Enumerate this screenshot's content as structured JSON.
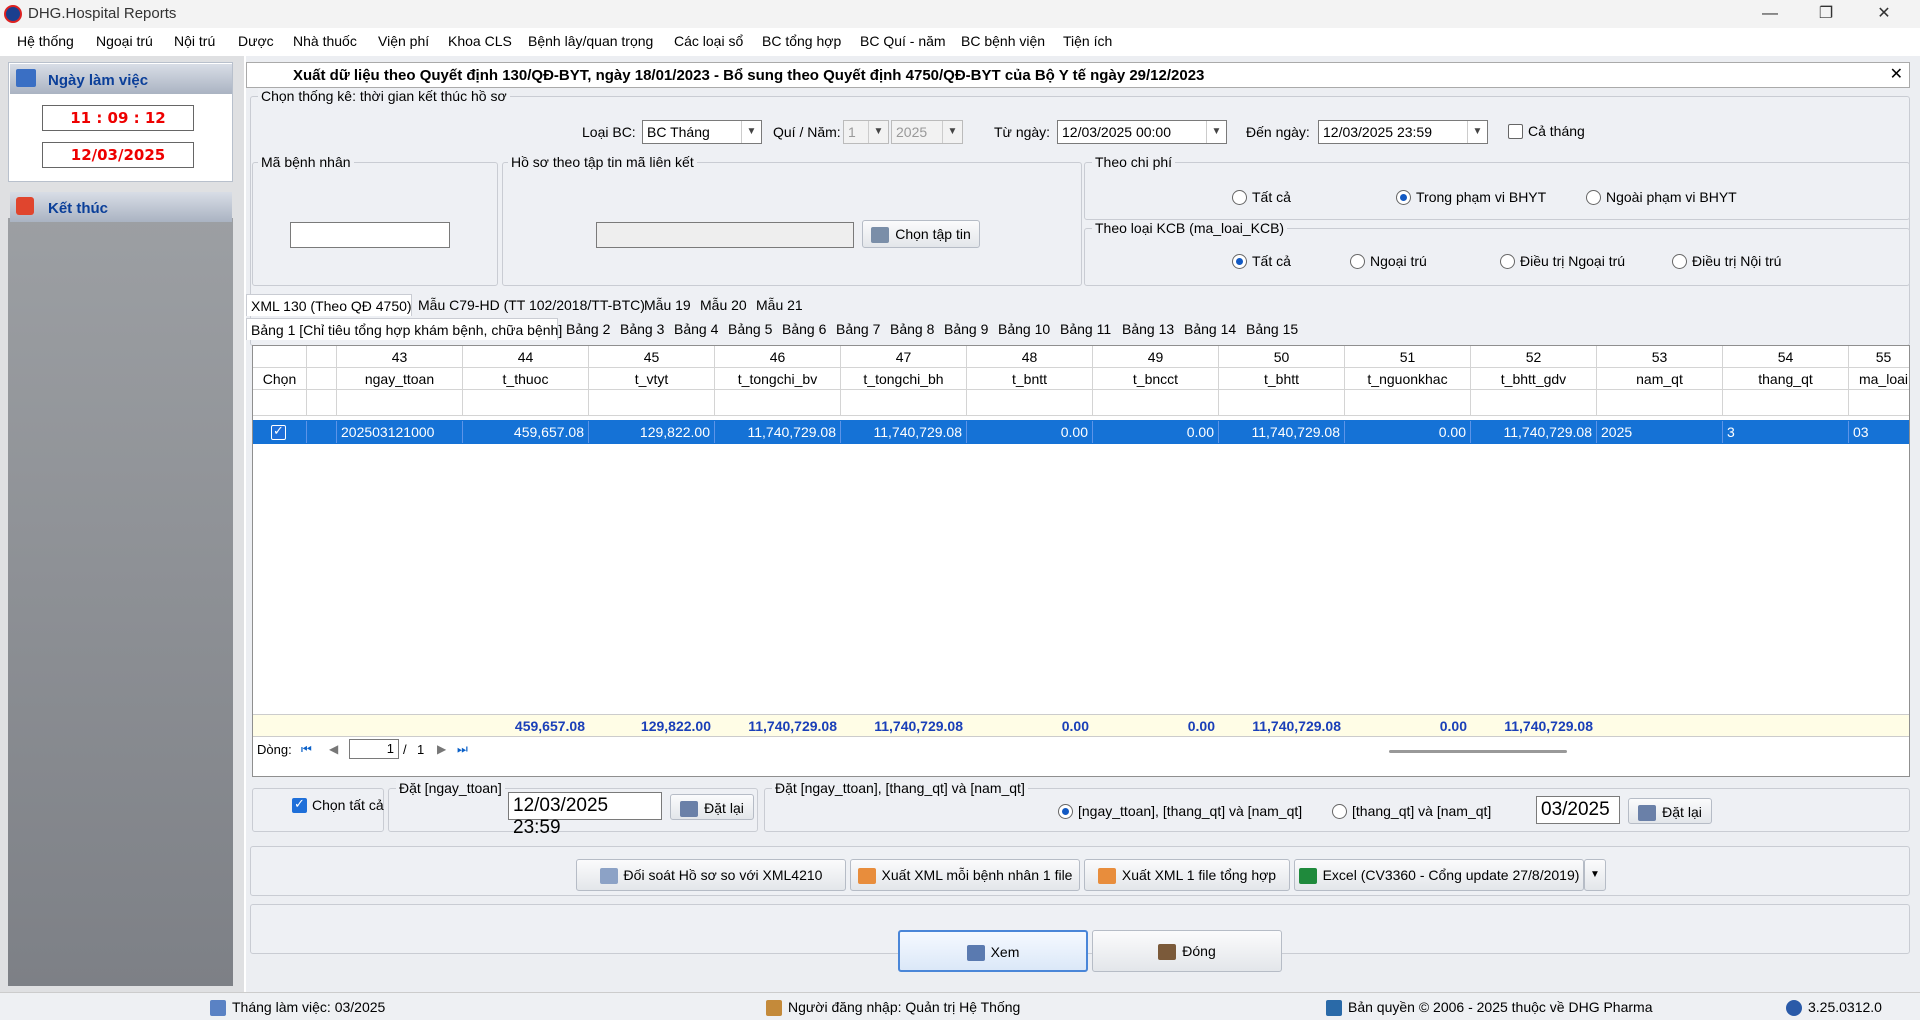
{
  "app": {
    "title": "DHG.Hospital Reports"
  },
  "menu": [
    "Hệ thống",
    "Ngoại trú",
    "Nội trú",
    "Dược",
    "Nhà thuốc",
    "Viện phí",
    "Khoa CLS",
    "Bệnh lây/quan trọng",
    "Các loại sổ",
    "BC tổng hợp",
    "BC Quí - năm",
    "BC bệnh viện",
    "Tiện ích"
  ],
  "sidebar": {
    "work_day_label": "Ngày làm việc",
    "time": "11 : 09 : 12",
    "date": "12/03/2025",
    "exit_label": "Kết thúc"
  },
  "form": {
    "title": "Xuất dữ liệu theo Quyết định 130/QĐ-BYT, ngày 18/01/2023 - Bổ sung theo Quyết định 4750/QĐ-BYT của Bộ Y tế ngày 29/12/2023",
    "stat_group": "Chọn thống kê: thời gian kết thúc hồ sơ",
    "loai_bc_label": "Loại BC:",
    "loai_bc_value": "BC Tháng",
    "quy_nam_label": "Quí / Năm:",
    "quy_value": "1",
    "nam_value": "2025",
    "tu_ngay_label": "Từ ngày:",
    "tu_ngay_value": "12/03/2025 00:00",
    "den_ngay_label": "Đến ngày:",
    "den_ngay_value": "12/03/2025 23:59",
    "ca_thang_label": "Cả tháng",
    "ma_bn_label": "Mã bệnh nhân",
    "ho_so_label": "Hồ sơ theo tập tin mã liên kết",
    "chon_tap_tin": "Chọn tập tin",
    "theo_chi_phi_label": "Theo chi phí",
    "chi_phi_options": [
      "Tất cả",
      "Trong phạm vi BHYT",
      "Ngoài phạm vi BHYT"
    ],
    "theo_loai_kcb_label": "Theo loại KCB (ma_loai_KCB)",
    "kcb_options": [
      "Tất cả",
      "Ngoại trú",
      "Điều trị Ngoại trú",
      "Điều trị Nội trú"
    ]
  },
  "tabs_top": [
    "XML 130 (Theo QĐ 4750)",
    "Mẫu C79-HD (TT 102/2018/TT-BTC)",
    "Mẫu 19",
    "Mẫu 20",
    "Mẫu 21"
  ],
  "tabs_sub": [
    "Bảng 1 [Chỉ tiêu tổng hợp khám bệnh, chữa bệnh]",
    "Bảng 2",
    "Bảng 3",
    "Bảng 4",
    "Bảng 5",
    "Bảng 6",
    "Bảng 7",
    "Bảng 8",
    "Bảng 9",
    "Bảng 10",
    "Bảng 11",
    "Bảng 13",
    "Bảng 14",
    "Bảng 15"
  ],
  "grid": {
    "col_numbers": [
      "",
      "",
      "43",
      "44",
      "45",
      "46",
      "47",
      "48",
      "49",
      "50",
      "51",
      "52",
      "53",
      "54",
      "55"
    ],
    "col_names": [
      "Chọn",
      "",
      "ngay_ttoan",
      "t_thuoc",
      "t_vtyt",
      "t_tongchi_bv",
      "t_tongchi_bh",
      "t_bntt",
      "t_bncct",
      "t_bhtt",
      "t_nguonkhac",
      "t_bhtt_gdv",
      "nam_qt",
      "thang_qt",
      "ma_loai"
    ],
    "row": [
      "",
      "",
      "202503121000",
      "459,657.08",
      "129,822.00",
      "11,740,729.08",
      "11,740,729.08",
      "0.00",
      "0.00",
      "11,740,729.08",
      "0.00",
      "11,740,729.08",
      "2025",
      "3",
      "03"
    ],
    "totals": [
      "",
      "",
      "",
      "459,657.08",
      "129,822.00",
      "11,740,729.08",
      "11,740,729.08",
      "0.00",
      "0.00",
      "11,740,729.08",
      "0.00",
      "11,740,729.08",
      "",
      "",
      ""
    ]
  },
  "pager": {
    "label": "Dòng:",
    "page": "1",
    "of": "/",
    "total": "1"
  },
  "bottom": {
    "chon_tat_ca": "Chọn tất cả",
    "dat_ngay_label": "Đặt [ngay_ttoan]",
    "dat_ngay_value": "12/03/2025 23:59",
    "dat_lai": "Đặt lại",
    "dat_group_label": "Đặt  [ngay_ttoan], [thang_qt] và [nam_qt]",
    "opt1": "[ngay_ttoan], [thang_qt] và [nam_qt]",
    "opt2": "[thang_qt] và [nam_qt]",
    "thang_value": "03/2025",
    "dat_lai2": "Đặt lại"
  },
  "actions": {
    "doi_soat": "Đối soát Hồ sơ so với XML4210",
    "xuat_moi": "Xuất XML mỗi bệnh nhân 1 file",
    "xuat_tong": "Xuất XML 1 file tổng hợp",
    "excel": "Excel (CV3360 - Cổng update 27/8/2019)",
    "xem": "Xem",
    "dong": "Đóng"
  },
  "status": {
    "thang": "Tháng làm việc: 03/2025",
    "user": "Người đăng nhập: Quản trị Hệ Thống",
    "copyright": "Bản quyền © 2006 - 2025 thuộc về DHG Pharma",
    "version": "3.25.0312.0"
  }
}
